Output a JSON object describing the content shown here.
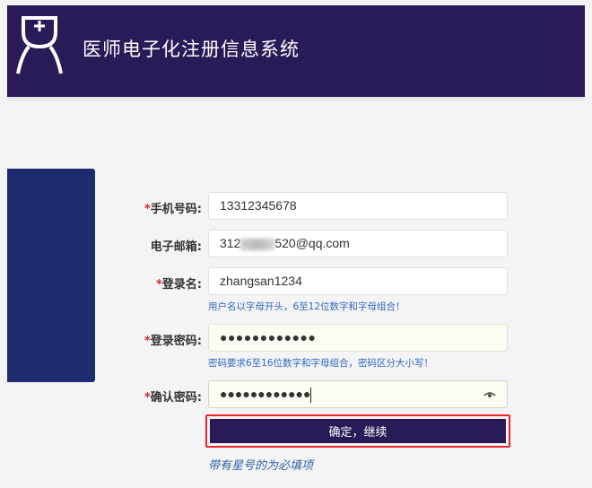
{
  "header": {
    "title": "医师电子化注册信息系统",
    "logo_icon": "doctor-nurse-icon",
    "bg_color": "#2a1a58"
  },
  "form": {
    "required_mark": "*",
    "fields": [
      {
        "label": "手机号码:",
        "required": true,
        "value": "13312345678"
      },
      {
        "label": "电子邮箱:",
        "required": false,
        "value_prefix": "312",
        "value_suffix": "520@qq.com"
      },
      {
        "label": "登录名:",
        "required": true,
        "value": "zhangsan1234",
        "hint": "用户名以字母开头，6至12位数字和字母组合！"
      },
      {
        "label": "登录密码:",
        "required": true,
        "value": "●●●●●●●●●●●●",
        "hint": "密码要求6至16位数字和字母组合，密码区分大小写！"
      },
      {
        "label": "确认密码:",
        "required": true,
        "value": "●●●●●●●●●●●●",
        "icon": "eye-icon"
      }
    ],
    "submit_label": "确定，继续",
    "required_note": "带有星号的为必填项",
    "accent_color": "#2a1a58",
    "highlight_color": "#e5252a",
    "hint_color": "#2f66c2"
  }
}
